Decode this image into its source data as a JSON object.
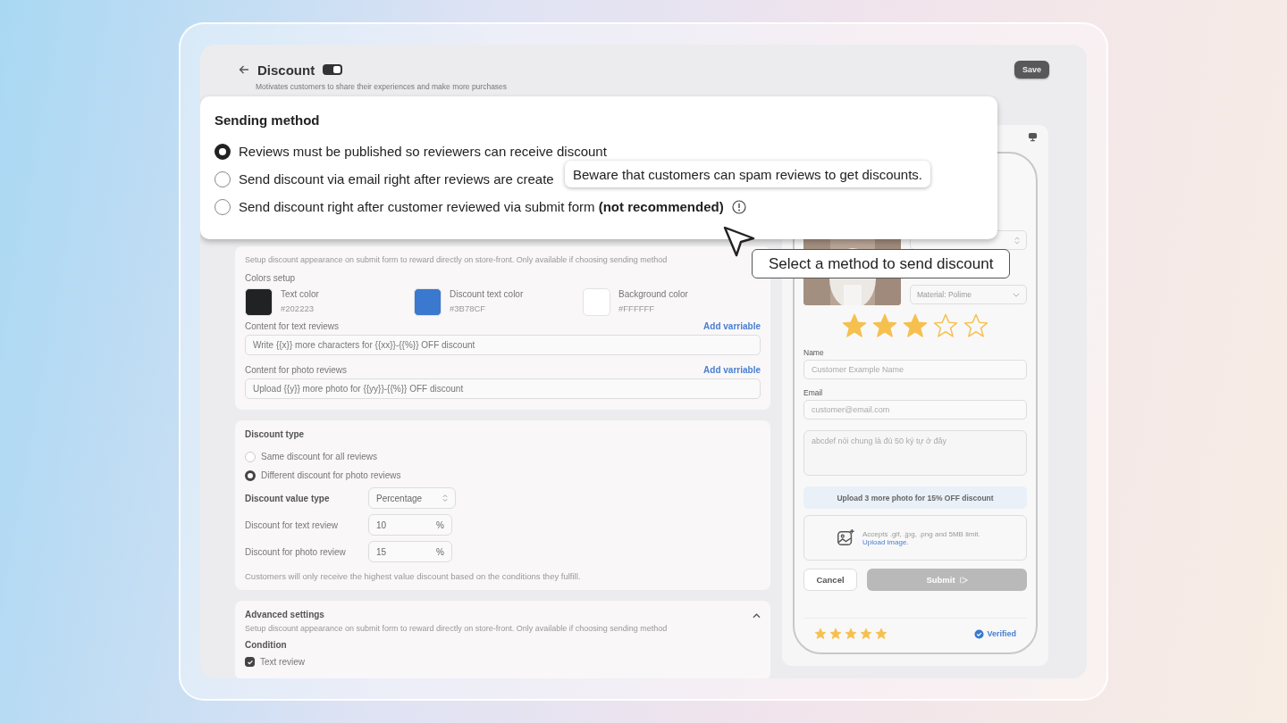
{
  "header": {
    "title": "Discount",
    "enabled": true,
    "subtitle": "Motivates customers to share their experiences and make more purchases",
    "save_label": "Save"
  },
  "sending_method": {
    "title": "Sending method",
    "options": [
      {
        "label": "Reviews must be published so reviewers can receive discount",
        "selected": true,
        "warning": false
      },
      {
        "label": "Send discount via email right after reviews are create",
        "selected": false,
        "warning": false
      },
      {
        "label": "Send discount right after customer reviewed via submit form **(not recommended)**",
        "selected": false,
        "warning": true
      }
    ],
    "tooltip": "Beware that customers can spam reviews to get discounts."
  },
  "callout": "Select a method to send discount",
  "appearance": {
    "description": "Setup discount appearance on submit form to reward directly on store-front. Only available if choosing sending method",
    "colors_title": "Colors setup",
    "colors": [
      {
        "label": "Text color",
        "value": "#202223",
        "color": "#202223"
      },
      {
        "label": "Discount text color",
        "value": "#3B78CF",
        "color": "#3b78cf"
      },
      {
        "label": "Background color",
        "value": "#FFFFFF",
        "color": "#ffffff"
      }
    ],
    "contents": [
      {
        "label": "Content for text reviews",
        "action": "Add varriable",
        "value": "Write {{x}} more characters for {{xx}}-{{%}} OFF discount"
      },
      {
        "label": "Content for photo reviews",
        "action": "Add varriable",
        "value": "Upload {{y}} more photo for {{yy}}-{{%}} OFF discount"
      }
    ]
  },
  "discount_type": {
    "title": "Discount type",
    "options": [
      {
        "label": "Same discount for all reviews",
        "selected": false
      },
      {
        "label": "Different discount for photo reviews",
        "selected": true
      }
    ],
    "value_type": {
      "label": "Discount value type",
      "value": "Percentage"
    },
    "fields": [
      {
        "label": "Discount for text review",
        "value": "10",
        "unit": "%"
      },
      {
        "label": "Discount for photo review",
        "value": "15",
        "unit": "%"
      }
    ],
    "note": "Customers will only receive the highest value discount based on the conditions they fulfill."
  },
  "advanced": {
    "title": "Advanced settings",
    "expanded": true,
    "description": "Setup discount appearance on submit form to reward directly on store-front. Only available if choosing sending method",
    "condition_title": "Condition",
    "conditions": [
      {
        "label": "Text review",
        "checked": true
      }
    ]
  },
  "preview": {
    "variant": "Material: Polime",
    "rating": {
      "stars": 3
    },
    "fields": [
      {
        "label": "Name",
        "placeholder": "Customer Example Name"
      },
      {
        "label": "Email",
        "placeholder": "customer@email.com"
      }
    ],
    "message_placeholder": "abcdef nói chung là đủ 50 ký tự ở đây",
    "banner": "Upload 3 more photo for **15% OFF** discount",
    "upload_hint": "Accepts .gif, .jpg, .png and 5MB limit.",
    "upload_link": "Upload image.",
    "cancel": "Cancel",
    "submit": {
      "label": "Submit",
      "disabled": true
    },
    "review": {
      "stars": 5,
      "verified": "Verified"
    }
  }
}
